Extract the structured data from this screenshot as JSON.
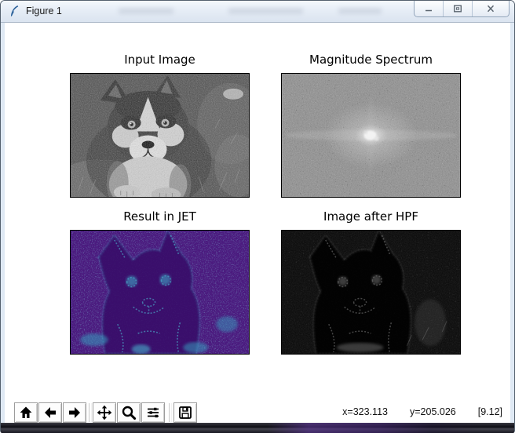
{
  "window": {
    "title": "Figure 1",
    "app_icon": "matplotlib-feather-icon",
    "controls": [
      {
        "name": "minimize",
        "icon": "minimize-icon"
      },
      {
        "name": "maximize",
        "icon": "maximize-icon"
      },
      {
        "name": "close",
        "icon": "close-icon"
      }
    ]
  },
  "figure": {
    "panels": [
      {
        "id": "input-image",
        "title": "Input Image",
        "type": "grayscale-photo",
        "description": "grayscale husky puppy lying in grass"
      },
      {
        "id": "magnitude-spectrum",
        "title": "Magnitude Spectrum",
        "type": "fft-magnitude",
        "description": "gray noise field with bright central peak"
      },
      {
        "id": "result-jet",
        "title": "Result in JET",
        "type": "jet-colormap",
        "description": "dark purple field with cyan edge speckles"
      },
      {
        "id": "image-after-hpf",
        "title": "Image after HPF",
        "type": "high-pass-filtered",
        "description": "near-black field with faint gray edge detail"
      }
    ]
  },
  "toolbar": {
    "buttons": [
      {
        "name": "home",
        "icon": "home-icon"
      },
      {
        "name": "back",
        "icon": "back-arrow-icon"
      },
      {
        "name": "forward",
        "icon": "forward-arrow-icon"
      },
      {
        "name": "pan",
        "icon": "pan-arrows-icon"
      },
      {
        "name": "zoom",
        "icon": "zoom-magnifier-icon"
      },
      {
        "name": "configure-subplots",
        "icon": "sliders-icon"
      },
      {
        "name": "save",
        "icon": "save-floppy-icon"
      }
    ]
  },
  "statusbar": {
    "x": "x=323.113",
    "y": "y=205.026",
    "value": "[9.12]"
  },
  "colors": {
    "jet_base": "#44117b",
    "jet_speckle": "#3fc0d6",
    "spectrum_gray": "#8b8b8b",
    "hpf_base": "#060606",
    "canvas_bg": "#ffffff",
    "titlebar_bg": "#e4ecf6",
    "bottom_strip": "#17151f",
    "purple_tint": "#4a2a78"
  }
}
